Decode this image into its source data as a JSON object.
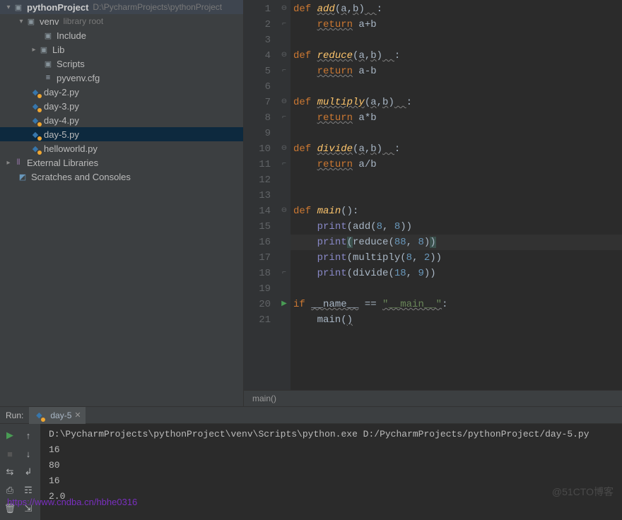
{
  "project": {
    "name": "pythonProject",
    "path": "D:\\PycharmProjects\\pythonProject"
  },
  "tree": {
    "venv": {
      "label": "venv",
      "hint": "library root"
    },
    "include": "Include",
    "lib": "Lib",
    "scripts": "Scripts",
    "pyvenv": "pyvenv.cfg",
    "files": [
      "day-2.py",
      "day-3.py",
      "day-4.py",
      "day-5.py",
      "helloworld.py"
    ],
    "external": "External Libraries",
    "scratches": "Scratches and Consoles"
  },
  "selected_file": "day-5.py",
  "code": {
    "lines": [
      {
        "n": 1,
        "fold": "⊖",
        "tokens": [
          [
            "kw",
            "def "
          ],
          [
            "fn wavy",
            "add"
          ],
          [
            "op",
            "("
          ],
          [
            "param wavy",
            "a"
          ],
          [
            "op",
            ","
          ],
          [
            "param wavy",
            "b"
          ],
          [
            "op",
            ")"
          ],
          [
            "wavy",
            "  "
          ],
          [
            "op",
            ":"
          ]
        ]
      },
      {
        "n": 2,
        "fold": "⌐",
        "tokens": [
          [
            "",
            "    "
          ],
          [
            "kw wavy",
            "return"
          ],
          [
            "op",
            " a+b"
          ]
        ]
      },
      {
        "n": 3,
        "tokens": []
      },
      {
        "n": 4,
        "fold": "⊖",
        "tokens": [
          [
            "kw",
            "def "
          ],
          [
            "fn wavy",
            "reduce"
          ],
          [
            "op",
            "("
          ],
          [
            "param wavy",
            "a"
          ],
          [
            "op",
            ","
          ],
          [
            "param wavy",
            "b"
          ],
          [
            "op",
            ")"
          ],
          [
            "wavy",
            "  "
          ],
          [
            "op",
            ":"
          ]
        ]
      },
      {
        "n": 5,
        "fold": "⌐",
        "tokens": [
          [
            "",
            "    "
          ],
          [
            "kw wavy",
            "return"
          ],
          [
            "op",
            " a-b"
          ]
        ]
      },
      {
        "n": 6,
        "tokens": []
      },
      {
        "n": 7,
        "fold": "⊖",
        "tokens": [
          [
            "kw",
            "def "
          ],
          [
            "fn wavy",
            "multiply"
          ],
          [
            "op",
            "("
          ],
          [
            "param wavy",
            "a"
          ],
          [
            "op",
            ","
          ],
          [
            "param wavy",
            "b"
          ],
          [
            "op",
            ")"
          ],
          [
            "wavy",
            "  "
          ],
          [
            "op",
            ":"
          ]
        ]
      },
      {
        "n": 8,
        "fold": "⌐",
        "tokens": [
          [
            "",
            "    "
          ],
          [
            "kw wavy",
            "return"
          ],
          [
            "op",
            " a*b"
          ]
        ]
      },
      {
        "n": 9,
        "tokens": []
      },
      {
        "n": 10,
        "fold": "⊖",
        "tokens": [
          [
            "kw",
            "def "
          ],
          [
            "fn wavy",
            "divide"
          ],
          [
            "op",
            "("
          ],
          [
            "param wavy",
            "a"
          ],
          [
            "op",
            ","
          ],
          [
            "param wavy",
            "b"
          ],
          [
            "op",
            ")"
          ],
          [
            "wavy",
            "  "
          ],
          [
            "op",
            ":"
          ]
        ]
      },
      {
        "n": 11,
        "fold": "⌐",
        "tokens": [
          [
            "",
            "    "
          ],
          [
            "kw wavy",
            "return"
          ],
          [
            "op",
            " a/b"
          ]
        ]
      },
      {
        "n": 12,
        "tokens": []
      },
      {
        "n": 13,
        "tokens": []
      },
      {
        "n": 14,
        "fold": "⊖",
        "tokens": [
          [
            "kw",
            "def "
          ],
          [
            "fn",
            "main"
          ],
          [
            "op",
            "():"
          ]
        ]
      },
      {
        "n": 15,
        "tokens": [
          [
            "",
            "    "
          ],
          [
            "builtin",
            "print"
          ],
          [
            "op",
            "("
          ],
          [
            "",
            "add("
          ],
          [
            "num",
            "8"
          ],
          [
            "op",
            ", "
          ],
          [
            "num",
            "8"
          ],
          [
            "op",
            "))"
          ]
        ]
      },
      {
        "n": 16,
        "current": true,
        "tokens": [
          [
            "",
            "    "
          ],
          [
            "builtin",
            "print"
          ],
          [
            "op hb",
            "("
          ],
          [
            "",
            "reduce("
          ],
          [
            "num",
            "88"
          ],
          [
            "op",
            ", "
          ],
          [
            "num",
            "8"
          ],
          [
            "op",
            ")"
          ],
          [
            "op hb",
            ")"
          ]
        ]
      },
      {
        "n": 17,
        "tokens": [
          [
            "",
            "    "
          ],
          [
            "builtin",
            "print"
          ],
          [
            "op",
            "("
          ],
          [
            "",
            "multiply("
          ],
          [
            "num",
            "8"
          ],
          [
            "op",
            ", "
          ],
          [
            "num",
            "2"
          ],
          [
            "op",
            "))"
          ]
        ]
      },
      {
        "n": 18,
        "fold": "⌐",
        "tokens": [
          [
            "",
            "    "
          ],
          [
            "builtin",
            "print"
          ],
          [
            "op",
            "("
          ],
          [
            "",
            "divide("
          ],
          [
            "num",
            "18"
          ],
          [
            "op",
            ", "
          ],
          [
            "num",
            "9"
          ],
          [
            "op",
            "))"
          ]
        ]
      },
      {
        "n": 19,
        "tokens": []
      },
      {
        "n": 20,
        "run": true,
        "tokens": [
          [
            "kw",
            "if "
          ],
          [
            "wavy",
            "__name__"
          ],
          [
            "op",
            " == "
          ],
          [
            "str wavy",
            "\"__main__\""
          ],
          [
            "op",
            ":"
          ]
        ]
      },
      {
        "n": 21,
        "tokens": [
          [
            "",
            "    main("
          ],
          [
            "wavy",
            ")"
          ]
        ]
      }
    ]
  },
  "breadcrumb": "main()",
  "run": {
    "label": "Run:",
    "tab": "day-5",
    "output": [
      "D:\\PycharmProjects\\pythonProject\\venv\\Scripts\\python.exe D:/PycharmProjects/pythonProject/day-5.py",
      "16",
      "80",
      "16",
      "2.0"
    ]
  },
  "watermark": "https://www.cndba.cn/hbhe0316",
  "watermark2": "@51CTO博客"
}
